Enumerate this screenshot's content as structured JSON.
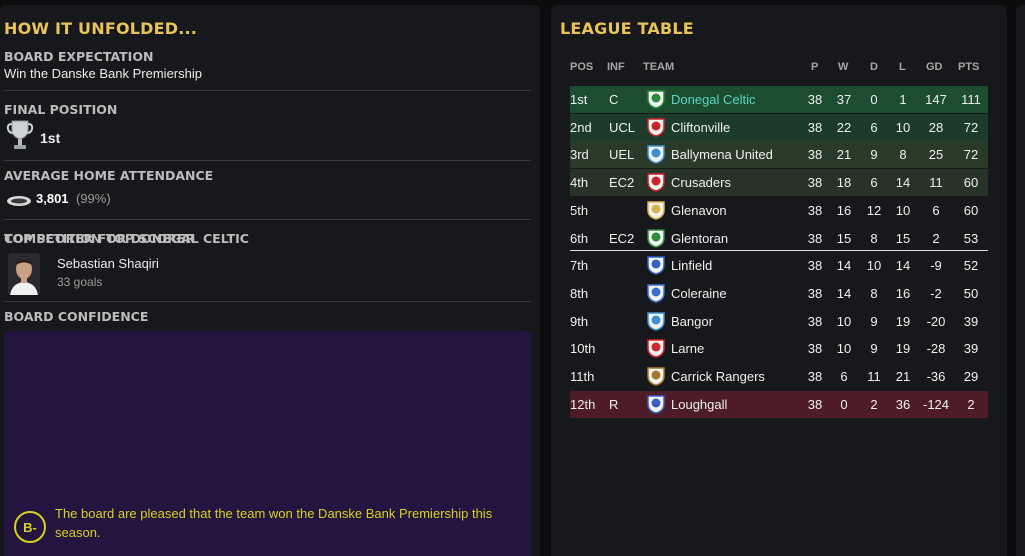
{
  "left": {
    "title": "HOW IT UNFOLDED...",
    "board_expectation": {
      "label": "BOARD EXPECTATION",
      "value": "Win the Danske Bank Premiership"
    },
    "final_position": {
      "label": "FINAL POSITION",
      "value": "1st"
    },
    "attendance": {
      "label": "AVERAGE HOME ATTENDANCE",
      "value": "3,801",
      "pct": "(99%)"
    },
    "top_scorer": {
      "label_a": "COMPETITION TOP SCORER",
      "label_b": "TOP SCORER FOR DONEGAL CELTIC",
      "player": "Sebastian Shaqiri",
      "goals": "33 goals"
    },
    "board_confidence": {
      "label": "BOARD CONFIDENCE",
      "grade": "B-",
      "text": "The board are pleased that the team won the Danske Bank Premiership this season."
    }
  },
  "league": {
    "title": "LEAGUE TABLE",
    "headers": {
      "pos": "POS",
      "inf": "INF",
      "team": "TEAM",
      "p": "P",
      "w": "W",
      "d": "D",
      "l": "L",
      "gd": "GD",
      "pts": "PTS"
    },
    "rows": [
      {
        "pos": "1st",
        "inf": "C",
        "team": "Donegal Celtic",
        "p": "38",
        "w": "37",
        "d": "0",
        "l": "1",
        "gd": "147",
        "pts": "111",
        "badge_color": "#2e8b3a"
      },
      {
        "pos": "2nd",
        "inf": "UCL",
        "team": "Cliftonville",
        "p": "38",
        "w": "22",
        "d": "6",
        "l": "10",
        "gd": "28",
        "pts": "72",
        "badge_color": "#c8242c"
      },
      {
        "pos": "3rd",
        "inf": "UEL",
        "team": "Ballymena United",
        "p": "38",
        "w": "21",
        "d": "9",
        "l": "8",
        "gd": "25",
        "pts": "72",
        "badge_color": "#3a8fd6"
      },
      {
        "pos": "4th",
        "inf": "EC2",
        "team": "Crusaders",
        "p": "38",
        "w": "18",
        "d": "6",
        "l": "14",
        "gd": "11",
        "pts": "60",
        "badge_color": "#c8242c"
      },
      {
        "pos": "5th",
        "inf": "",
        "team": "Glenavon",
        "p": "38",
        "w": "16",
        "d": "12",
        "l": "10",
        "gd": "6",
        "pts": "60",
        "badge_color": "#d7b44a"
      },
      {
        "pos": "6th",
        "inf": "EC2",
        "team": "Glentoran",
        "p": "38",
        "w": "15",
        "d": "8",
        "l": "15",
        "gd": "2",
        "pts": "53",
        "badge_color": "#2e8b3a"
      },
      {
        "pos": "7th",
        "inf": "",
        "team": "Linfield",
        "p": "38",
        "w": "14",
        "d": "10",
        "l": "14",
        "gd": "-9",
        "pts": "52",
        "badge_color": "#2f5fc4"
      },
      {
        "pos": "8th",
        "inf": "",
        "team": "Coleraine",
        "p": "38",
        "w": "14",
        "d": "8",
        "l": "16",
        "gd": "-2",
        "pts": "50",
        "badge_color": "#3a6fd0"
      },
      {
        "pos": "9th",
        "inf": "",
        "team": "Bangor",
        "p": "38",
        "w": "10",
        "d": "9",
        "l": "19",
        "gd": "-20",
        "pts": "39",
        "badge_color": "#3a8fd6"
      },
      {
        "pos": "10th",
        "inf": "",
        "team": "Larne",
        "p": "38",
        "w": "10",
        "d": "9",
        "l": "19",
        "gd": "-28",
        "pts": "39",
        "badge_color": "#d2262e"
      },
      {
        "pos": "11th",
        "inf": "",
        "team": "Carrick Rangers",
        "p": "38",
        "w": "6",
        "d": "11",
        "l": "21",
        "gd": "-36",
        "pts": "29",
        "badge_color": "#a8782a"
      },
      {
        "pos": "12th",
        "inf": "R",
        "team": "Loughgall",
        "p": "38",
        "w": "0",
        "d": "2",
        "l": "36",
        "gd": "-124",
        "pts": "2",
        "badge_color": "#3a5fc4"
      }
    ]
  },
  "colors": {
    "accent_title": "#e8c25a",
    "champion_row": "#1c4d2e",
    "relegation_row": "#4d1c26",
    "confidence_bg": "#241540",
    "grade": "#d8d21a"
  }
}
